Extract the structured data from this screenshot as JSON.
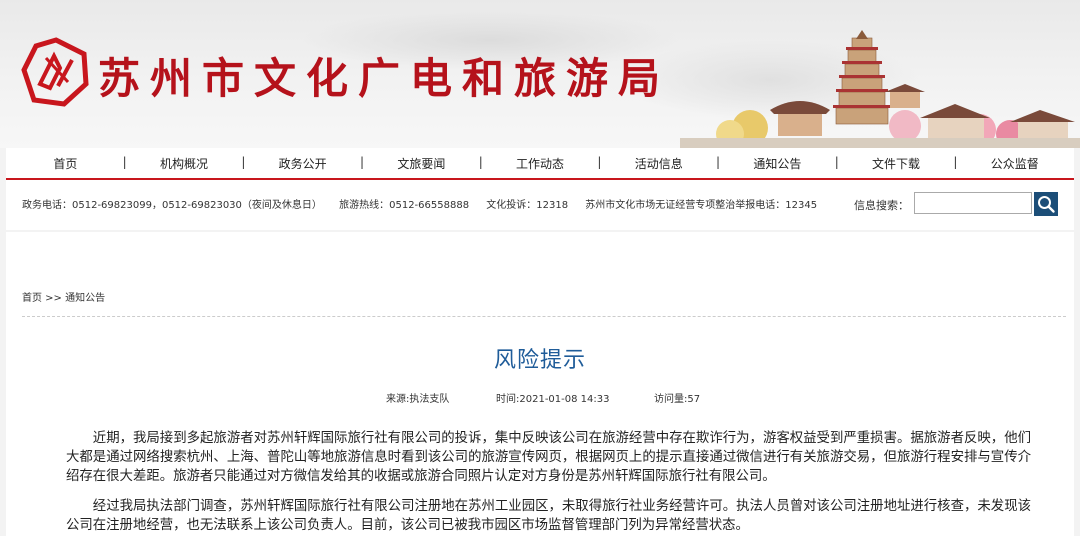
{
  "header": {
    "site_title": "苏州市文化广电和旅游局"
  },
  "nav": {
    "items": [
      "首页",
      "机构概况",
      "政务公开",
      "文旅要闻",
      "工作动态",
      "活动信息",
      "通知公告",
      "文件下载",
      "公众监督"
    ]
  },
  "infobar": {
    "gov_phone": "政务电话：0512-69823099，0512-69823030（夜间及休息日）",
    "tour_hotline": "旅游热线：0512-66558888",
    "culture_complaint": "文化投诉：12318",
    "market_report": "苏州市文化市场无证经营专项整治举报电话：12345",
    "search_label": "信息搜索：",
    "search_value": ""
  },
  "breadcrumb": {
    "home": "首页",
    "separator": " >> ",
    "current": "通知公告"
  },
  "article": {
    "title": "风险提示",
    "source": "来源:执法支队",
    "time": "时间:2021-01-08 14:33",
    "views": "访问量:57",
    "paragraphs": [
      "近期，我局接到多起旅游者对苏州轩辉国际旅行社有限公司的投诉，集中反映该公司在旅游经营中存在欺诈行为，游客权益受到严重损害。据旅游者反映，他们大都是通过网络搜索杭州、上海、普陀山等地旅游信息时看到该公司的旅游宣传网页，根据网页上的提示直接通过微信进行有关旅游交易，但旅游行程安排与宣传介绍存在很大差距。旅游者只能通过对方微信发给其的收据或旅游合同照片认定对方身份是苏州轩辉国际旅行社有限公司。",
      "经过我局执法部门调查，苏州轩辉国际旅行社有限公司注册地在苏州工业园区，未取得旅行社业务经营许可。执法人员曾对该公司注册地址进行核查，未发现该公司在注册地经营，也无法联系上该公司负责人。目前，该公司已被我市园区市场监督管理部门列为异常经营状态。"
    ]
  },
  "colors": {
    "brand_red": "#b5121b",
    "title_blue": "#1f5c99",
    "search_button": "#1c4e78"
  }
}
